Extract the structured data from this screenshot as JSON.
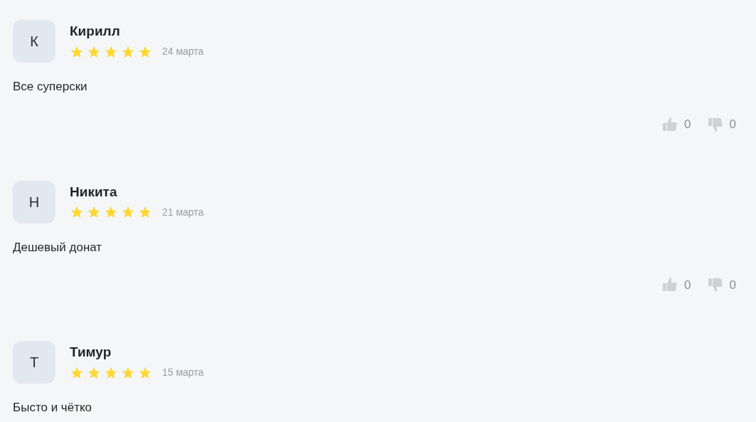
{
  "reviews": [
    {
      "initial": "К",
      "name": "Кирилл",
      "stars": 5,
      "date": "24 марта",
      "text": "Все суперски",
      "likes": "0",
      "dislikes": "0"
    },
    {
      "initial": "Н",
      "name": "Никита",
      "stars": 5,
      "date": "21 марта",
      "text": "Дешевый донат",
      "likes": "0",
      "dislikes": "0"
    },
    {
      "initial": "Т",
      "name": "Тимур",
      "stars": 5,
      "date": "15 марта",
      "text": "Бысто и чётко"
    }
  ]
}
